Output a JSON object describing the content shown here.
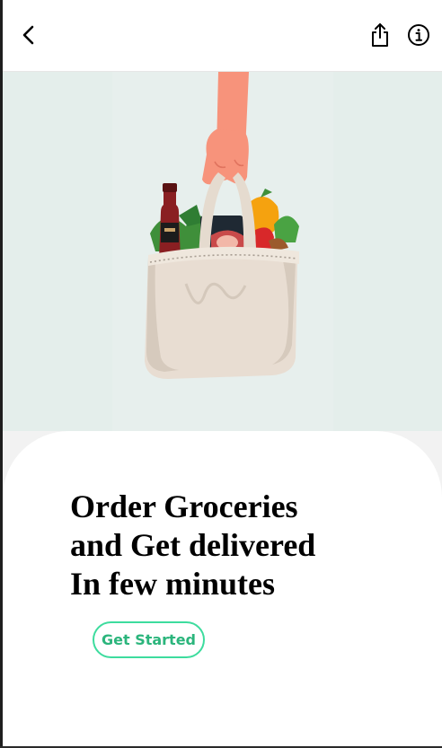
{
  "header": {
    "back_icon": "chevron-left-icon",
    "share_icon": "share-icon",
    "info_icon": "info-icon"
  },
  "hero": {
    "illustration": "grocery-bag-illustration",
    "colors": {
      "background": "#e4eeeb",
      "skin": "#f7937b",
      "bag": "#e8ddd2",
      "wine": "#8a1f22"
    }
  },
  "content": {
    "headline_lines": [
      "Order Groceries",
      "and Get delivered",
      "In few minutes"
    ],
    "cta_label": "Get Started"
  },
  "colors": {
    "accent_border": "#3ddc9e",
    "accent_text": "#2bb57c"
  }
}
